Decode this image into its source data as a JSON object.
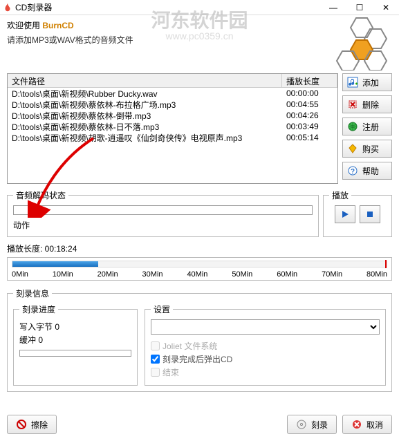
{
  "window": {
    "title": "CD刻录器",
    "minimize": "—",
    "maximize": "☐",
    "close": "✕"
  },
  "watermark": {
    "main": "河东软件园",
    "sub": "www.pc0359.cn"
  },
  "header": {
    "welcome_prefix": "欢迎使用 ",
    "brand": "BurnCD",
    "instruction": "请添加MP3或WAV格式的音频文件"
  },
  "filelist": {
    "col_path": "文件路径",
    "col_duration": "播放长度",
    "rows": [
      {
        "path": "D:\\tools\\桌面\\新视频\\Rubber Ducky.wav",
        "dur": "00:00:00"
      },
      {
        "path": "D:\\tools\\桌面\\新视频\\蔡依林-布拉格广场.mp3",
        "dur": "00:04:55"
      },
      {
        "path": "D:\\tools\\桌面\\新视频\\蔡依林-倒带.mp3",
        "dur": "00:04:26"
      },
      {
        "path": "D:\\tools\\桌面\\新视频\\蔡依林-日不落.mp3",
        "dur": "00:03:49"
      },
      {
        "path": "D:\\tools\\桌面\\新视频\\胡歌-逍遥叹《仙剑奇侠传》电视原声.mp3",
        "dur": "00:05:14"
      }
    ]
  },
  "sidebar": {
    "add": "添加",
    "delete": "删除",
    "register": "注册",
    "buy": "购买",
    "help": "帮助"
  },
  "decode": {
    "legend": "音频解码状态",
    "action_label": "动作"
  },
  "play": {
    "legend": "播放"
  },
  "length": {
    "label_prefix": "播放长度: ",
    "value": "00:18:24"
  },
  "ticks": [
    "0Min",
    "10Min",
    "20Min",
    "30Min",
    "40Min",
    "50Min",
    "60Min",
    "70Min",
    "80Min"
  ],
  "burn": {
    "legend": "刻录信息",
    "progress_legend": "刻录进度",
    "written_label": "写入字节",
    "written_value": "0",
    "buffer_label": "缓冲",
    "buffer_value": "0",
    "settings_legend": "设置",
    "opt_joliet": "Joliet 文件系统",
    "opt_eject": "刻录完成后弹出CD",
    "opt_finalize": "结束"
  },
  "footer": {
    "erase": "擦除",
    "burn": "刻录",
    "cancel": "取消"
  }
}
